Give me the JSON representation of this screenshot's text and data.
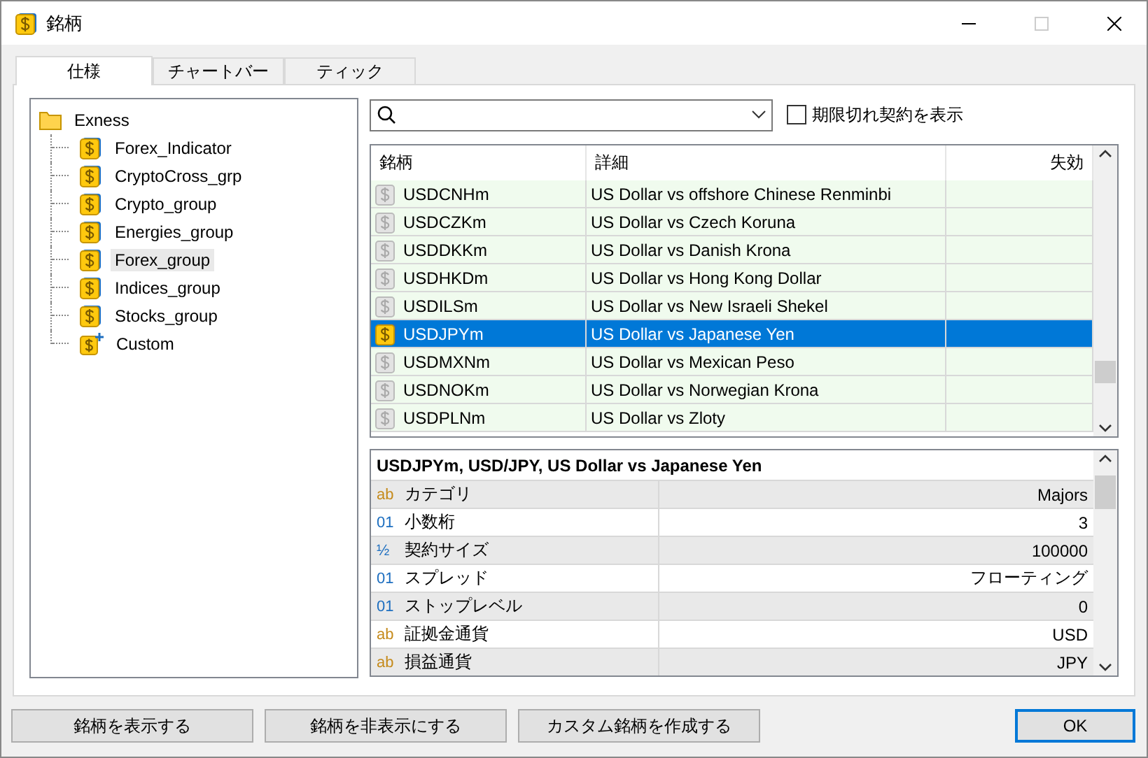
{
  "window": {
    "title": "銘柄"
  },
  "tabs": [
    {
      "label": "仕様",
      "selected": true
    },
    {
      "label": "チャートバー",
      "selected": false
    },
    {
      "label": "ティック",
      "selected": false
    }
  ],
  "tree": {
    "label": "Exness",
    "children": [
      {
        "label": "Forex_Indicator",
        "selected": false,
        "kind": "group"
      },
      {
        "label": "CryptoCross_grp",
        "selected": false,
        "kind": "group"
      },
      {
        "label": "Crypto_group",
        "selected": false,
        "kind": "group"
      },
      {
        "label": "Energies_group",
        "selected": false,
        "kind": "group"
      },
      {
        "label": "Forex_group",
        "selected": true,
        "kind": "group"
      },
      {
        "label": "Indices_group",
        "selected": false,
        "kind": "group"
      },
      {
        "label": "Stocks_group",
        "selected": false,
        "kind": "group"
      },
      {
        "label": "Custom",
        "selected": false,
        "kind": "custom"
      }
    ]
  },
  "show_expired": {
    "label": "期限切れ契約を表示",
    "checked": false
  },
  "symbols": {
    "columns": [
      "銘柄",
      "詳細",
      "失効"
    ],
    "rows": [
      {
        "symbol": "USDCNHm",
        "description": "US Dollar vs offshore Chinese Renminbi",
        "shown": false,
        "selected": false
      },
      {
        "symbol": "USDCZKm",
        "description": "US Dollar vs Czech Koruna",
        "shown": false,
        "selected": false
      },
      {
        "symbol": "USDDKKm",
        "description": "US Dollar vs Danish Krona",
        "shown": false,
        "selected": false
      },
      {
        "symbol": "USDHKDm",
        "description": "US Dollar vs Hong Kong Dollar",
        "shown": false,
        "selected": false
      },
      {
        "symbol": "USDILSm",
        "description": "US Dollar vs New Israeli Shekel",
        "shown": false,
        "selected": false
      },
      {
        "symbol": "USDJPYm",
        "description": "US Dollar vs Japanese Yen",
        "shown": true,
        "selected": true
      },
      {
        "symbol": "USDMXNm",
        "description": "US Dollar vs Mexican Peso",
        "shown": false,
        "selected": false
      },
      {
        "symbol": "USDNOKm",
        "description": "US Dollar vs Norwegian Krona",
        "shown": false,
        "selected": false
      },
      {
        "symbol": "USDPLNm",
        "description": "US Dollar vs Zloty",
        "shown": false,
        "selected": false
      }
    ]
  },
  "properties": {
    "title": "USDJPYm, USD/JPY, US Dollar vs Japanese Yen",
    "rows": [
      {
        "kind": "text",
        "mark": "ab",
        "name": "カテゴリ",
        "value": "Majors"
      },
      {
        "kind": "number",
        "mark": "01",
        "name": "小数桁",
        "value": "3"
      },
      {
        "kind": "fraction",
        "mark": "½",
        "name": "契約サイズ",
        "value": "100000"
      },
      {
        "kind": "number",
        "mark": "01",
        "name": "スプレッド",
        "value": "フローティング"
      },
      {
        "kind": "number",
        "mark": "01",
        "name": "ストップレベル",
        "value": "0"
      },
      {
        "kind": "text",
        "mark": "ab",
        "name": "証拠金通貨",
        "value": "USD"
      },
      {
        "kind": "text",
        "mark": "ab",
        "name": "損益通貨",
        "value": "JPY"
      }
    ]
  },
  "buttons": [
    {
      "label": "銘柄を表示する",
      "kind": "normal"
    },
    {
      "label": "銘柄を非表示にする",
      "kind": "normal"
    },
    {
      "label": "カスタム銘柄を作成する",
      "kind": "normal"
    },
    {
      "label": "OK",
      "kind": "default"
    }
  ]
}
